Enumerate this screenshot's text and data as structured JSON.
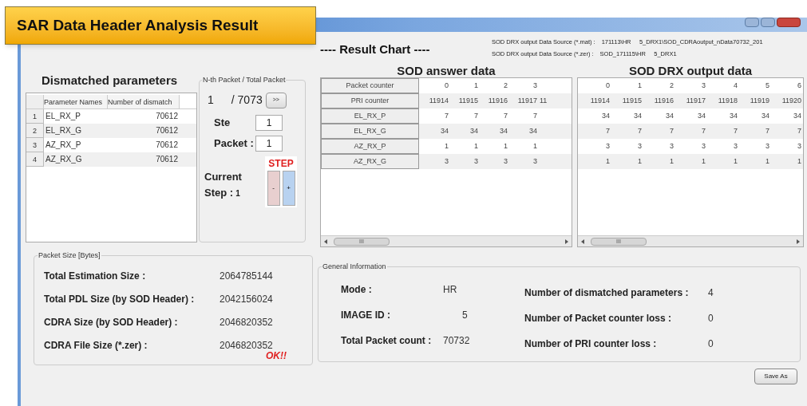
{
  "banner": {
    "title": "SAR Data Header Analysis Result"
  },
  "header": {
    "title": "---- Result Chart ----",
    "sources": [
      {
        "label": "SOD DRX output Data Source (*.mat) :",
        "value": "171113\\HR     5_DRX1\\SOD_CDRAoutput_nData70732_201"
      },
      {
        "label": "SOD DRX output Data Source (*.zer) :",
        "value": "SOD_171115\\HR     5_DRX1"
      }
    ]
  },
  "dismatched": {
    "title": "Dismatched parameters",
    "columns": [
      "Parameter Names",
      "Number of dismatch"
    ],
    "rows": [
      {
        "index": "1",
        "name": "EL_RX_P",
        "count": "70612"
      },
      {
        "index": "2",
        "name": "EL_RX_G",
        "count": "70612"
      },
      {
        "index": "3",
        "name": "AZ_RX_P",
        "count": "70612"
      },
      {
        "index": "4",
        "name": "AZ_RX_G",
        "count": "70612"
      }
    ]
  },
  "nth_packet": {
    "legend": "N-th Packet / Total Packet",
    "current": "1",
    "total": "/ 7073",
    "next_button": ">>",
    "ste_label": "Ste",
    "ste_value": "1",
    "packet_label": "Packet :",
    "packet_value": "1",
    "current_step_label": "Current",
    "step_label": "Step :",
    "step_value": "1",
    "step_title": "STEP",
    "minus_button": "-",
    "plus_button": "+"
  },
  "sod_answer": {
    "title": "SOD answer data",
    "rows": [
      {
        "label": "Packet counter",
        "values": [
          "0",
          "1",
          "2",
          "3"
        ]
      },
      {
        "label": "PRI counter",
        "values": [
          "11914",
          "11915",
          "11916",
          "11917",
          "11"
        ]
      },
      {
        "label": "EL_RX_P",
        "values": [
          "7",
          "7",
          "7",
          "7"
        ]
      },
      {
        "label": "EL_RX_G",
        "values": [
          "34",
          "34",
          "34",
          "34"
        ]
      },
      {
        "label": "AZ_RX_P",
        "values": [
          "1",
          "1",
          "1",
          "1"
        ]
      },
      {
        "label": "AZ_RX_G",
        "values": [
          "3",
          "3",
          "3",
          "3"
        ]
      }
    ],
    "scroll_grip": "III"
  },
  "sod_drx": {
    "title": "SOD DRX output data",
    "rows": [
      [
        "0",
        "1",
        "2",
        "3",
        "4",
        "5",
        "6"
      ],
      [
        "11914",
        "11915",
        "11916",
        "11917",
        "11918",
        "11919",
        "11920"
      ],
      [
        "34",
        "34",
        "34",
        "34",
        "34",
        "34",
        "34"
      ],
      [
        "7",
        "7",
        "7",
        "7",
        "7",
        "7",
        "7"
      ],
      [
        "3",
        "3",
        "3",
        "3",
        "3",
        "3",
        "3"
      ],
      [
        "1",
        "1",
        "1",
        "1",
        "1",
        "1",
        "1"
      ]
    ],
    "scroll_grip": "III"
  },
  "packet_size": {
    "legend": "Packet Size [Bytes]",
    "rows": [
      {
        "label": "Total Estimation Size :",
        "value": "2064785144"
      },
      {
        "label": "Total PDL Size (by SOD Header) :",
        "value": "2042156024"
      },
      {
        "label": "CDRA Size (by SOD Header) :",
        "value": "2046820352"
      },
      {
        "label": "CDRA File Size (*.zer) :",
        "value": "2046820352"
      }
    ],
    "status": "OK!!"
  },
  "general_info": {
    "legend": "General Information",
    "left": [
      {
        "label": "Mode :",
        "value": "HR"
      },
      {
        "label": "IMAGE ID :",
        "value": "5"
      },
      {
        "label": "Total Packet count :",
        "value": "70732"
      }
    ],
    "right": [
      {
        "label": "Number of dismatched parameters :",
        "value": "4"
      },
      {
        "label": "Number of Packet counter loss :",
        "value": "0"
      },
      {
        "label": "Number of PRI counter loss :",
        "value": "0"
      }
    ]
  },
  "save_button": "Save As"
}
